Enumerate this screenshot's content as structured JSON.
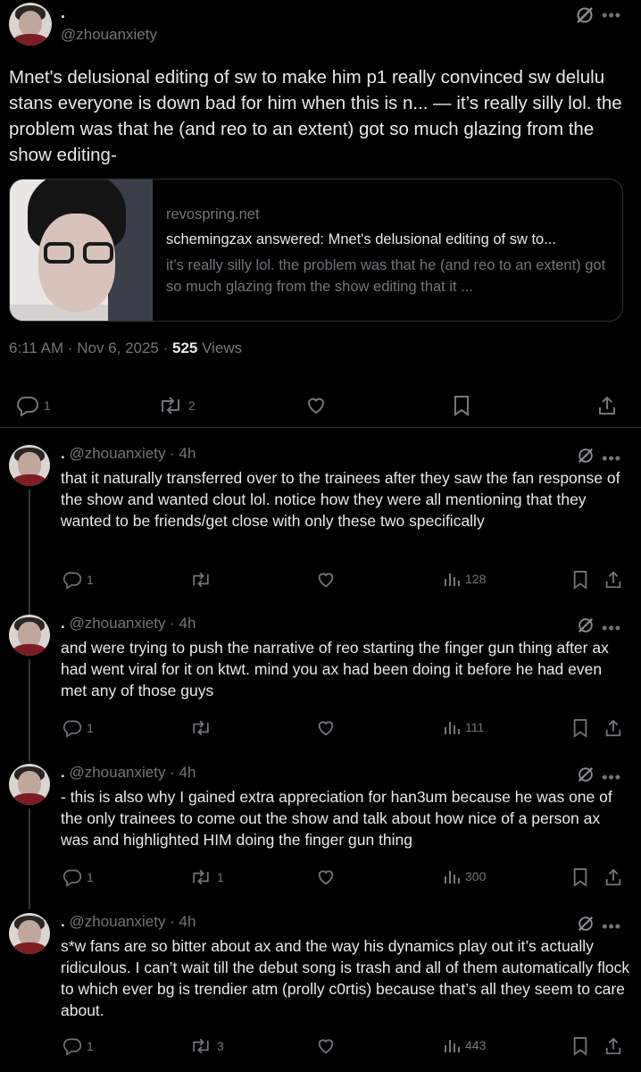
{
  "main_tweet": {
    "display_name": ".",
    "handle": "@zhouanxiety",
    "text": "Mnet's delusional editing of sw to make him p1 really convinced sw delulu stans everyone is down bad for him when this is n... — it’s really silly lol. the problem was that he (and reo to an extent) got so much glazing from the show editing-",
    "card": {
      "domain": "revospring.net",
      "title": "schemingzax answered: Mnet's delusional editing of sw to...",
      "description": "it’s really silly lol. the problem was that he (and reo to an extent) got so much glazing from the show editing that it ..."
    },
    "time": "6:11 AM · Nov 6, 2025 · ",
    "views_count": "525",
    "views_label": " Views",
    "replies": "1",
    "reposts": "2",
    "likes": "",
    "icons": [
      "grok-icon",
      "more-icon",
      "reply-icon",
      "repost-icon",
      "like-icon",
      "bookmark-icon",
      "share-icon"
    ]
  },
  "replies": [
    {
      "display_name": ".",
      "meta": " @zhouanxiety · 4h",
      "text": "that it naturally transferred over to the trainees after they saw the fan response of the show and wanted clout lol. notice how they were all mentioning that they wanted to be friends/get close with only these two specifically",
      "replies": "1",
      "reposts": "",
      "likes": "",
      "views": "128"
    },
    {
      "display_name": ".",
      "meta": " @zhouanxiety · 4h",
      "text": "and were trying to push the narrative of reo starting the finger gun thing after ax had went viral for it on ktwt. mind you ax had been doing it before he had even met any of those guys",
      "replies": "1",
      "reposts": "",
      "likes": "",
      "views": "111"
    },
    {
      "display_name": ".",
      "meta": " @zhouanxiety · 4h",
      "text": "- this is also why I gained extra appreciation for han3um because he was one of the only trainees to come out the show and talk about how nice of a person ax was and highlighted HIM doing the finger gun thing",
      "replies": "1",
      "reposts": "1",
      "likes": "",
      "views": "300"
    },
    {
      "display_name": ".",
      "meta": " @zhouanxiety · 4h",
      "text": "s*w fans are so bitter about ax and the way his dynamics play out it’s actually ridiculous. I can’t wait till the debut song is trash and all of them automatically flock to which ever bg is trendier atm (prolly c0rtis) because that’s all they seem to care about.",
      "replies": "1",
      "reposts": "3",
      "likes": "",
      "views": "443"
    }
  ],
  "colors": {
    "background": "#000000",
    "text": "#e7e9ea",
    "muted": "#71767b",
    "border": "#2f3336"
  }
}
